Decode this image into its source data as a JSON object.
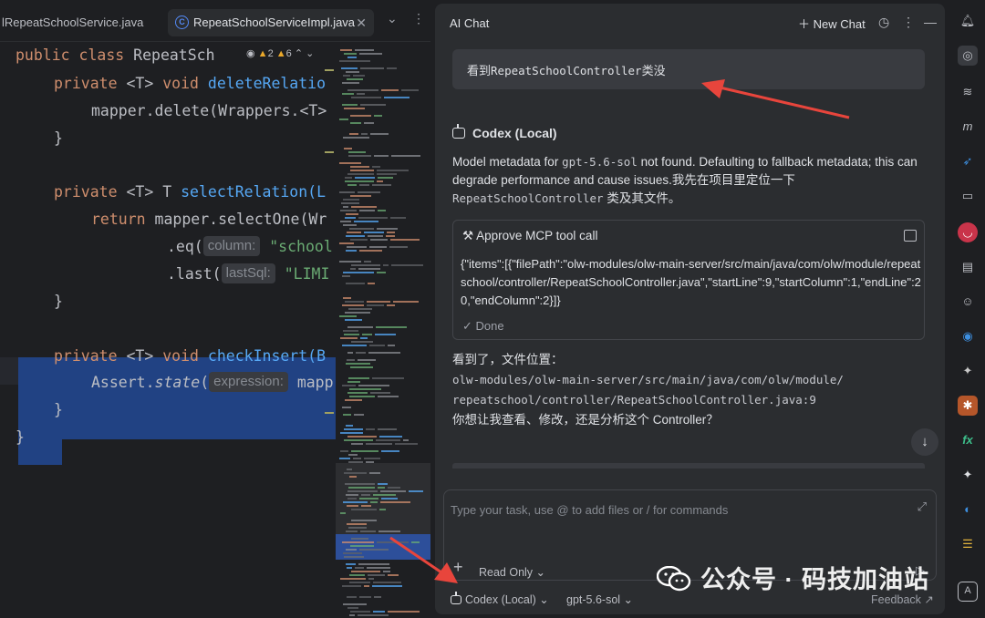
{
  "editor": {
    "tabs": [
      {
        "label": "lRepeatSchoolService.java"
      },
      {
        "label": "RepeatSchoolServiceImpl.java",
        "active": true
      }
    ],
    "tab_overflow": "⌄",
    "tab_menu": "⋮",
    "inspection": {
      "warnings": "2",
      "weak_warnings": "6"
    },
    "code": {
      "l1_a": "public class ",
      "l1_b": "RepeatSch",
      "l2_kw": "private ",
      "l2_t": "<T> ",
      "l2_kw2": "void ",
      "l2_fn": "deleteRelatio",
      "l3": "mapper.delete(Wrappers.<T>",
      "l4": "}",
      "l5_kw": "private ",
      "l5_t": "<T> T ",
      "l5_fn": "selectRelation(L",
      "l6_kw": "return ",
      "l6_b": "mapper.selectOne(Wr",
      "l7_a": ".eq(",
      "l7_hint": "column:",
      "l7_str": "\"school",
      "l8_a": ".last(",
      "l8_hint": "lastSql:",
      "l8_str": "\"LIMI",
      "l9": "}",
      "l10_kw": "private ",
      "l10_t": "<T> ",
      "l10_kw2": "void ",
      "l10_fn": "checkInsert(B",
      "l11_a": "Assert.",
      "l11_it": "state",
      "l11_b": "(",
      "l11_hint": "expression:",
      "l11_c": "mapp",
      "l12": "}",
      "l13": "}"
    }
  },
  "chat": {
    "title": "AI Chat",
    "new_chat": "New Chat",
    "user_message_prefix": "看到",
    "user_message_code": "RepeatSchoolController",
    "user_message_suffix": "类没",
    "agent_name": "Codex (Local)",
    "reply1_a": "Model metadata for ",
    "reply1_code": "gpt-5.6-sol",
    "reply1_b": " not found. Defaulting to fallback metadata; this can degrade performance and cause issues.我先在项目里定位一下 ",
    "reply1_code2": "RepeatSchoolController",
    "reply1_c": " 类及其文件。",
    "mcp_title": "Approve MCP tool call",
    "mcp_json": "{\"items\":[{\"filePath\":\"olw-modules/olw-main-server/src/main/java/com/olw/module/repeatschool/controller/RepeatSchoolController.java\",\"startLine\":9,\"startColumn\":1,\"endLine\":20,\"endColumn\":2}]}",
    "mcp_status": "Done",
    "reply2_a": "看到了，文件位置：",
    "reply2_path1": "olw-modules/olw-main-server/src/main/java/com/olw/module/",
    "reply2_path2": "repeatschool/controller/RepeatSchoolController.java:9",
    "reply2_b": "你想让我查看、修改，还是分析这个 Controller？",
    "input_placeholder": "Type your task, use @ to add files or / for commands",
    "mode": "Read Only",
    "model_agent": "Codex (Local)",
    "model_name": "gpt-5.6-sol",
    "feedback": "Feedback ↗"
  },
  "watermark": "公众号 · 码技加油站",
  "colors": {
    "accent_blue": "#548af7",
    "selection": "#214283",
    "annotation_arrow": "#e8453c",
    "keyword": "#cf8e6d",
    "function": "#56a8f5",
    "string": "#6aab73"
  },
  "toolbar_icons": [
    "notifications-icon",
    "ai-chat-icon",
    "database-icon",
    "maven-icon",
    "feather-icon",
    "folder-search-icon",
    "plugin-red-icon",
    "document-icon",
    "bot-icon",
    "globe-icon",
    "bird-icon",
    "puzzle-icon",
    "fx-icon",
    "sparkle-icon",
    "planet-icon",
    "translate-icon",
    "font-icon"
  ]
}
